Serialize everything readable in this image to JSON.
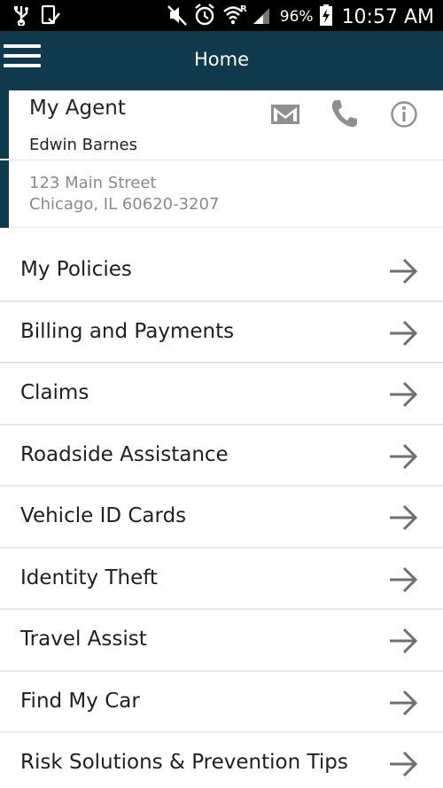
{
  "status_bar": {
    "battery_percent": "96%",
    "time": "10:57 AM",
    "icons": [
      "usb-icon",
      "screenshot-icon",
      "mute-icon",
      "alarm-icon",
      "wifi-icon",
      "signal-icon",
      "battery-charging-icon"
    ]
  },
  "app_bar": {
    "title": "Home",
    "menu_icon": "hamburger-icon"
  },
  "agent": {
    "title": "My Agent",
    "name": "Edwin Barnes",
    "address_line1": "123 Main Street",
    "address_line2": "Chicago, IL 60620-3207",
    "actions": [
      "mail-icon",
      "phone-icon",
      "info-icon"
    ]
  },
  "menu": {
    "items": [
      {
        "label": "My Policies"
      },
      {
        "label": "Billing and Payments"
      },
      {
        "label": "Claims"
      },
      {
        "label": "Roadside Assistance"
      },
      {
        "label": "Vehicle ID Cards"
      },
      {
        "label": "Identity Theft"
      },
      {
        "label": "Travel Assist"
      },
      {
        "label": "Find My Car"
      },
      {
        "label": "Risk Solutions & Prevention Tips"
      }
    ],
    "arrow_icon": "arrow-right-icon"
  },
  "colors": {
    "app_bar": "#0f3a4e",
    "status_bar": "#000000",
    "icon_gray": "#8a8a8a"
  }
}
